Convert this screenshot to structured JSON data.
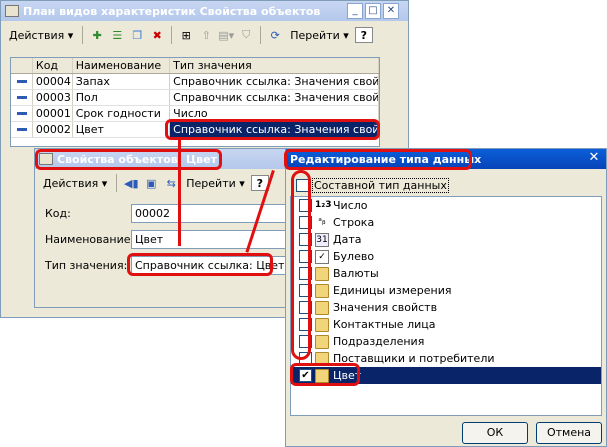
{
  "main_window": {
    "title": "План видов характеристик Свойства объектов",
    "toolbar": {
      "actions_label": "Действия",
      "goto_label": "Перейти",
      "help_label": "?"
    },
    "table": {
      "columns": [
        "Код",
        "Наименование",
        "Тип значения"
      ],
      "rows": [
        {
          "code": "00004",
          "name": "Запах",
          "type": "Справочник ссылка: Значения свойств"
        },
        {
          "code": "00003",
          "name": "Пол",
          "type": "Справочник ссылка: Значения свойств"
        },
        {
          "code": "00001",
          "name": "Срок годности",
          "type": "Число"
        },
        {
          "code": "00002",
          "name": "Цвет",
          "type": "Справочник ссылка: Значения свойств"
        }
      ]
    }
  },
  "detail_window": {
    "title": "Свойства объектов: Цвет",
    "toolbar": {
      "actions_label": "Действия",
      "goto_label": "Перейти",
      "help_label": "?"
    },
    "fields": {
      "code_label": "Код:",
      "code_value": "00002",
      "name_label": "Наименование:",
      "name_value": "Цвет",
      "type_label": "Тип значения:",
      "type_value": "Справочник ссылка: Цвет"
    }
  },
  "type_dialog": {
    "title": "Редактирование типа данных",
    "composite_label": "Составной тип данных",
    "types": [
      {
        "label": "Число",
        "icon": "number-icon",
        "checked": false
      },
      {
        "label": "Строка",
        "icon": "string-icon",
        "checked": false
      },
      {
        "label": "Дата",
        "icon": "date-icon",
        "checked": false
      },
      {
        "label": "Булево",
        "icon": "boolean-icon",
        "checked": false
      },
      {
        "label": "Валюты",
        "icon": "folder-icon",
        "checked": false
      },
      {
        "label": "Единицы измерения",
        "icon": "folder-icon",
        "checked": false
      },
      {
        "label": "Значения свойств",
        "icon": "folder-icon",
        "checked": false
      },
      {
        "label": "Контактные лица",
        "icon": "folder-icon",
        "checked": false
      },
      {
        "label": "Подразделения",
        "icon": "folder-icon",
        "checked": false
      },
      {
        "label": "Поставщики и потребители",
        "icon": "folder-icon",
        "checked": false
      },
      {
        "label": "Цвет",
        "icon": "folder-icon",
        "checked": true
      }
    ],
    "ok_label": "ОК",
    "cancel_label": "Отмена"
  },
  "colors": {
    "highlight": "#e01010",
    "selection": "#0a246a",
    "title_active": "#0a5fd9"
  }
}
